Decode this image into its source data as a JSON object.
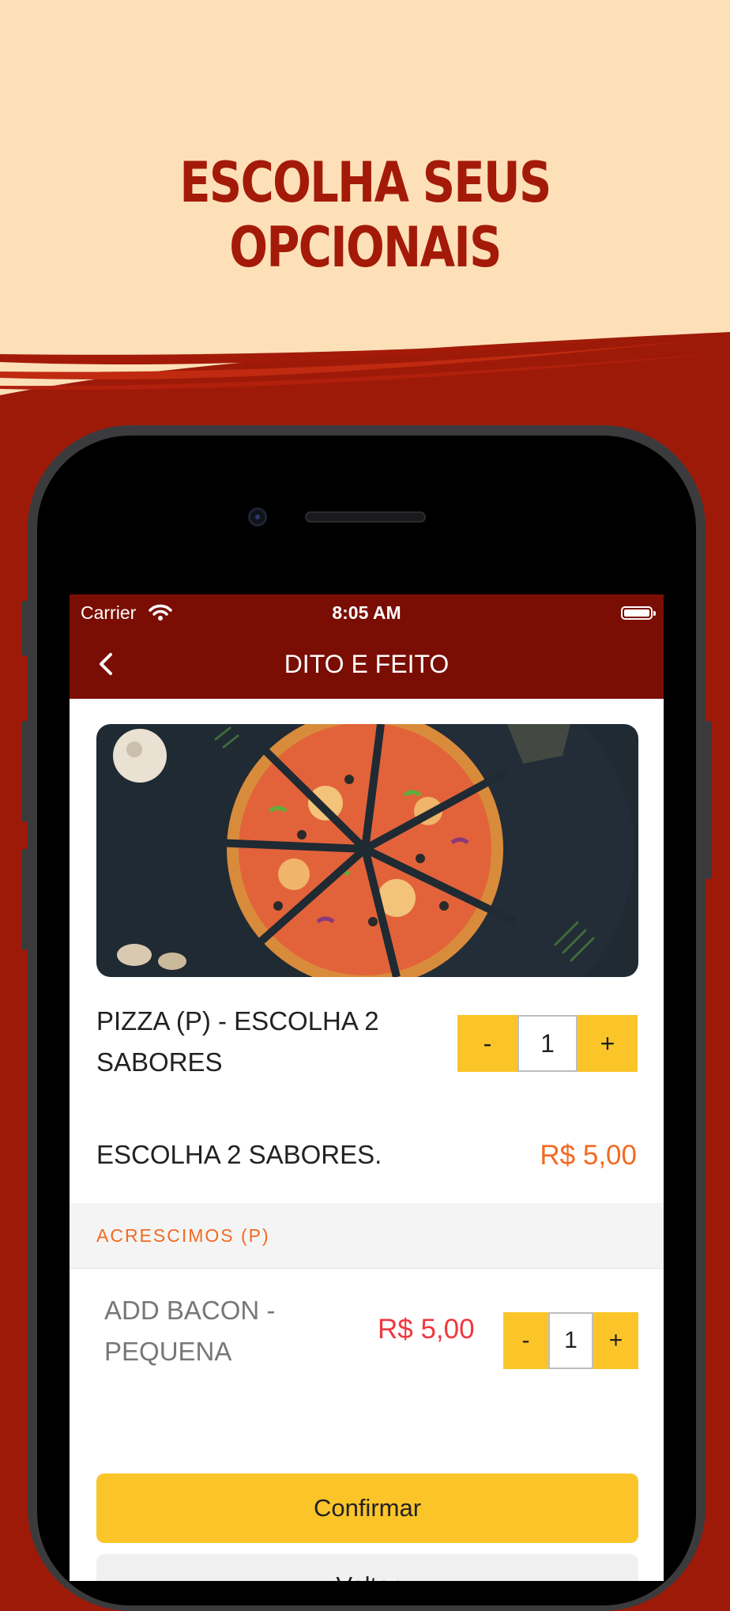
{
  "headline": "ESCOLHA SEUS OPCIONAIS",
  "colors": {
    "accent_red": "#9e1a08",
    "nav_red": "#7a0e04",
    "cream": "#fde0b8",
    "yellow": "#fbc52a",
    "orange": "#f26a21"
  },
  "status_bar": {
    "carrier": "Carrier",
    "time": "8:05 AM"
  },
  "nav": {
    "title": "DITO E FEITO",
    "back_icon": "chevron-left-icon"
  },
  "product": {
    "name": "PIZZA (P) - ESCOLHA 2 SABORES",
    "quantity": "1",
    "minus": "-",
    "plus": "+",
    "description": "ESCOLHA 2 SABORES.",
    "price": "R$ 5,00"
  },
  "section": {
    "title": "ACRESCIMOS (P)"
  },
  "option": {
    "name": "ADD BACON - PEQUENA",
    "price": "R$ 5,00",
    "quantity": "1",
    "minus": "-",
    "plus": "+"
  },
  "buttons": {
    "confirm": "Confirmar",
    "back": "Voltar"
  }
}
